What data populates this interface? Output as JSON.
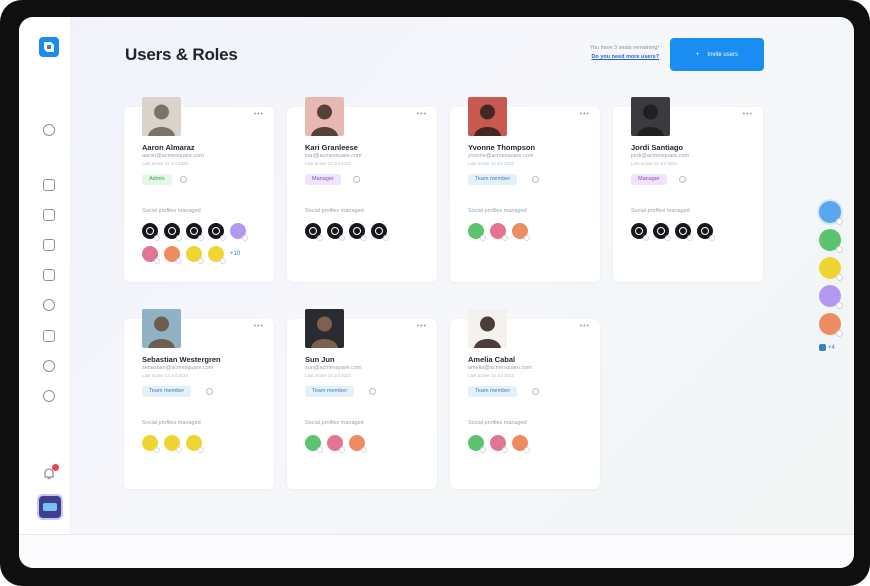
{
  "page": {
    "title": "Users & Roles",
    "seats_note": "You have 3 seats remaining!",
    "seats_link": "Do you need more users?",
    "invite_label": "Invite users",
    "invite_icon": "plus-icon",
    "social_label": "Social profiles managed"
  },
  "colors": {
    "accent": "#1b8df2",
    "admin_badge": "#3d9b4a",
    "manager_badge": "#8a4cc9",
    "team_badge": "#3a7fc2"
  },
  "users": [
    {
      "name": "Aaron Almaraz",
      "email": "aaron@acmesquare.com",
      "last_seen": "Last active 12 Jul 2022",
      "role": "Admin",
      "profiles_row1": [
        "black",
        "black",
        "black",
        "black",
        "purple"
      ],
      "profiles_row2": [
        "pink",
        "orange",
        "yellow",
        "yellow"
      ],
      "more": "+10"
    },
    {
      "name": "Kari Granleese",
      "email": "kari@acmesquare.com",
      "last_seen": "Last active 12 Jul 2022",
      "role": "Manager",
      "profiles_row1": [
        "black",
        "black",
        "black",
        "black"
      ],
      "profiles_row2": []
    },
    {
      "name": "Yvonne Thompson",
      "email": "yvonne@acmesquare.com",
      "last_seen": "Last active 12 Jul 2022",
      "role": "Team member",
      "profiles_row1": [
        "green",
        "pink",
        "orange"
      ],
      "profiles_row2": []
    },
    {
      "name": "Jordi Santiago",
      "email": "jordi@acmesquare.com",
      "last_seen": "Last active 12 Jul 2022",
      "role": "Manager",
      "profiles_row1": [
        "black",
        "black",
        "black",
        "black"
      ],
      "profiles_row2": []
    },
    {
      "name": "Sebastian Westergren",
      "email": "sebastian@acmesquare.com",
      "last_seen": "Last active 12 Jul 2022",
      "role": "Team member",
      "profiles_row1": [
        "yellow",
        "yellow",
        "yellow"
      ],
      "profiles_row2": []
    },
    {
      "name": "Sun Jun",
      "email": "sun@acmesquare.com",
      "last_seen": "Last active 12 Jul 2022",
      "role": "Team member",
      "profiles_row1": [
        "green",
        "pink",
        "orange"
      ],
      "profiles_row2": []
    },
    {
      "name": "Amelia Cabal",
      "email": "amelia@acmesquare.com",
      "last_seen": "Last active 12 Jul 2022",
      "role": "Team member",
      "profiles_row1": [
        "green",
        "pink",
        "orange"
      ],
      "profiles_row2": []
    }
  ],
  "right_rail": {
    "profiles": [
      "blue",
      "green",
      "yellow",
      "purple",
      "orange"
    ],
    "more": "+4"
  },
  "nav_icons": [
    "clock-icon",
    "calendar-icon",
    "analytics-icon",
    "compose-icon",
    "media-icon",
    "chat-icon",
    "library-icon",
    "comment-icon",
    "settings-icon"
  ]
}
